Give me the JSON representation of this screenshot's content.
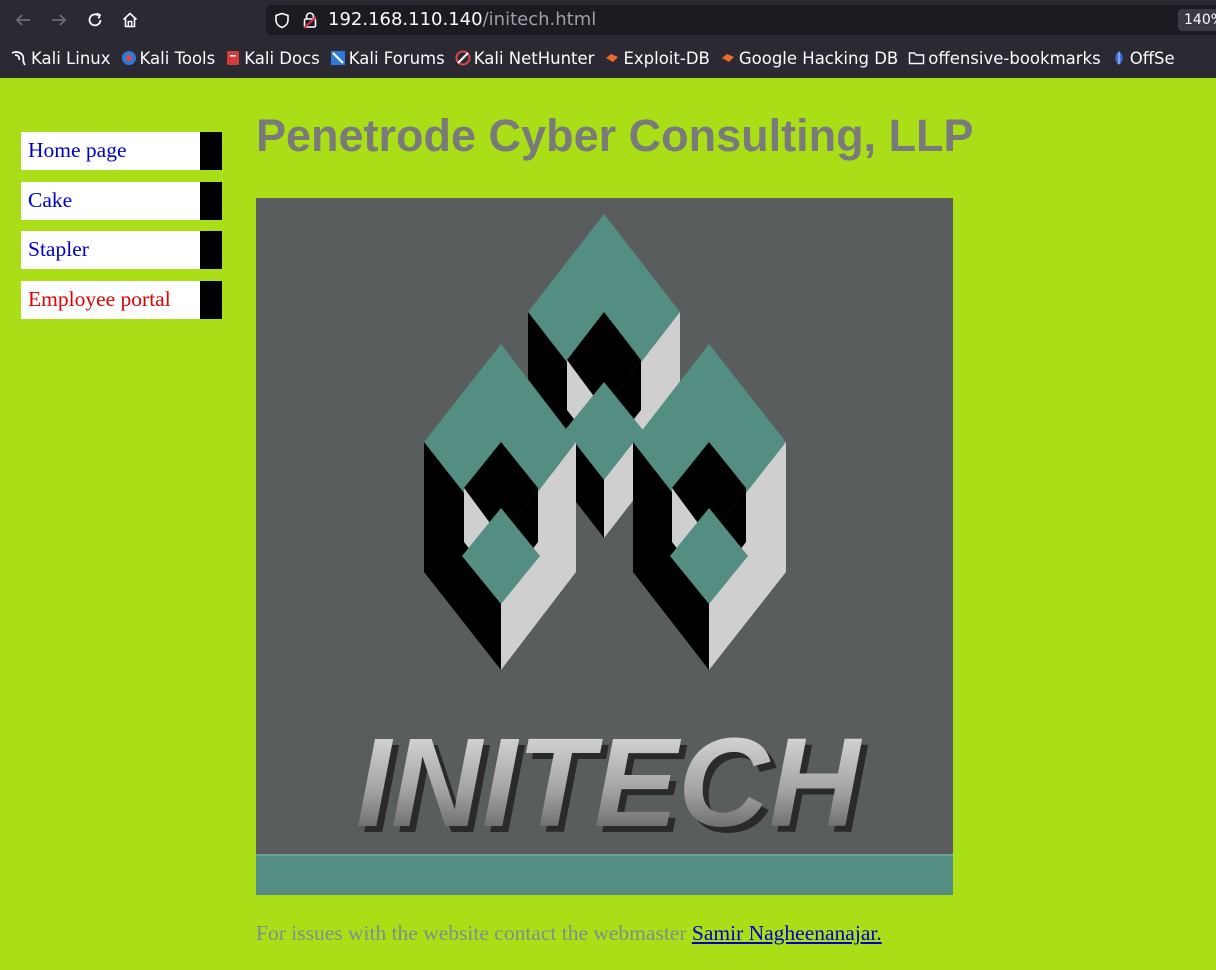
{
  "browser": {
    "url_host": "192.168.110.140",
    "url_path": "/initech.html",
    "zoom": "140%",
    "bookmarks": [
      {
        "label": "Kali Linux",
        "icon": "kali-dragon-icon"
      },
      {
        "label": "Kali Tools",
        "icon": "kali-tools-icon"
      },
      {
        "label": "Kali Docs",
        "icon": "kali-docs-icon"
      },
      {
        "label": "Kali Forums",
        "icon": "kali-forums-icon"
      },
      {
        "label": "Kali NetHunter",
        "icon": "kali-nethunter-icon"
      },
      {
        "label": "Exploit-DB",
        "icon": "exploit-db-icon"
      },
      {
        "label": "Google Hacking DB",
        "icon": "ghdb-icon"
      },
      {
        "label": "offensive-bookmarks",
        "icon": "folder-icon"
      },
      {
        "label": "OffSe",
        "icon": "offsec-icon"
      }
    ]
  },
  "sidebar": {
    "items": [
      {
        "label": "Home page"
      },
      {
        "label": "Cake"
      },
      {
        "label": "Stapler"
      },
      {
        "label": "Employee portal"
      }
    ]
  },
  "page": {
    "title": "Penetrode Cyber Consulting, LLP",
    "logo_text": "INITECH",
    "footer_text": "For issues with the website contact the webmaster ",
    "webmaster_link": "Samir Nagheenanajar."
  },
  "colors": {
    "page_background": "#aadf18",
    "logo_background": "#5a5d5d",
    "logo_teal": "#548d82",
    "link": "#0000c8",
    "active_link": "#e00000"
  }
}
